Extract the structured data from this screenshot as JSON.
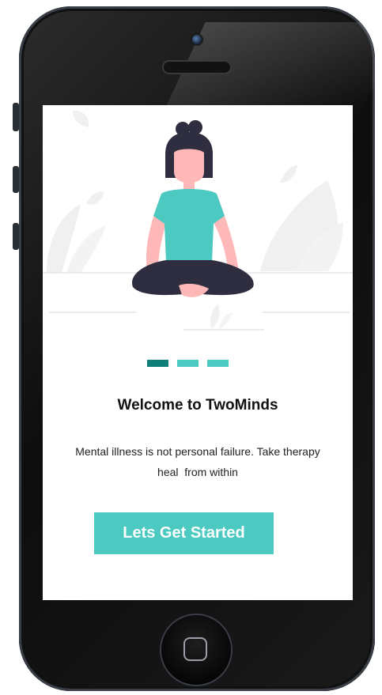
{
  "app": {
    "title": "Welcome to TwoMinds",
    "subtitle_line1": "Mental illness is not personal failure. Take therapy",
    "subtitle_line2": "heal  from within",
    "cta_label": "Lets Get Started"
  },
  "pager": {
    "total": 3,
    "active_index": 0
  },
  "colors": {
    "accent": "#4cc9c0",
    "accent_dark": "#0f7f78",
    "figure_top": "#4cc9c0",
    "figure_hair": "#2f2e41",
    "figure_skin": "#ffb8b8",
    "figure_legs": "#2f2e41",
    "background_plants": "#f0f0f0"
  },
  "icons": {
    "home_button": "home-button-icon",
    "camera": "front-camera-icon",
    "speaker": "earpiece-speaker-icon",
    "illustration": "meditating-person-icon"
  }
}
